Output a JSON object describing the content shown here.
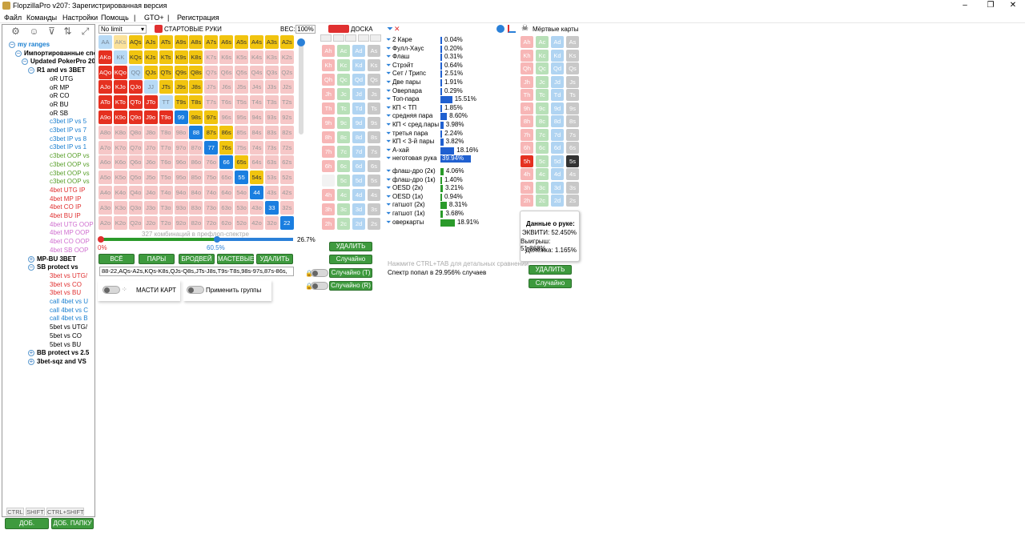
{
  "window": {
    "title": "FlopzillaPro v207: Зарегистрированная версия",
    "minimize": "–",
    "maximize": "❐",
    "close": "✕"
  },
  "menu": [
    "Файл",
    "Команды",
    "Настройки",
    "Помощь",
    "|",
    "GTO+",
    "|",
    "Регистрация"
  ],
  "tree": [
    {
      "label": "my ranges",
      "color": "#1a7fd0",
      "tog": "−",
      "indent": 0,
      "bold": true
    },
    {
      "label": "Импортированные спектры",
      "color": "#000",
      "tog": "−",
      "indent": 1,
      "bold": true
    },
    {
      "label": "Updated PokerPro 2018",
      "color": "#000",
      "tog": "−",
      "indent": 2,
      "bold": true
    },
    {
      "label": "R1 and vs 3BET",
      "color": "#000",
      "tog": "−",
      "indent": 3,
      "bold": true
    },
    {
      "label": "oR UTG",
      "color": "#000",
      "indent": 5
    },
    {
      "label": "oR MP",
      "color": "#000",
      "indent": 5
    },
    {
      "label": "oR CO",
      "color": "#000",
      "indent": 5
    },
    {
      "label": "oR BU",
      "color": "#000",
      "indent": 5
    },
    {
      "label": "oR SB",
      "color": "#000",
      "indent": 5
    },
    {
      "label": "c3bet IP vs 5",
      "color": "#1a7fd0",
      "indent": 5
    },
    {
      "label": "c3bet IP vs 7",
      "color": "#1a7fd0",
      "indent": 5
    },
    {
      "label": "c3bet IP vs 8",
      "color": "#1a7fd0",
      "indent": 5
    },
    {
      "label": "c3bet IP vs 1",
      "color": "#1a7fd0",
      "indent": 5
    },
    {
      "label": "c3bet OOP vs",
      "color": "#5aa02c",
      "indent": 5
    },
    {
      "label": "c3bet OOP vs",
      "color": "#5aa02c",
      "indent": 5
    },
    {
      "label": "c3bet OOP vs",
      "color": "#5aa02c",
      "indent": 5
    },
    {
      "label": "c3bet OOP vs",
      "color": "#5aa02c",
      "indent": 5
    },
    {
      "label": "4bet UTG IP",
      "color": "#e03030",
      "indent": 5
    },
    {
      "label": "4bet MP IP",
      "color": "#e03030",
      "indent": 5
    },
    {
      "label": "4bet CO IP",
      "color": "#e03030",
      "indent": 5
    },
    {
      "label": "4bet BU IP",
      "color": "#e03030",
      "indent": 5
    },
    {
      "label": "4bet UTG OOP",
      "color": "#d070d0",
      "indent": 5
    },
    {
      "label": "4bet MP OOP",
      "color": "#d070d0",
      "indent": 5
    },
    {
      "label": "4bet CO OOP",
      "color": "#d070d0",
      "indent": 5
    },
    {
      "label": "4bet SB OOP",
      "color": "#d070d0",
      "indent": 5
    },
    {
      "label": "MP-BU 3BET",
      "color": "#000",
      "tog": "+",
      "indent": 3,
      "bold": true
    },
    {
      "label": "SB protect vs",
      "color": "#000",
      "tog": "−",
      "indent": 3,
      "bold": true
    },
    {
      "label": "3bet vs UTG/",
      "color": "#e03030",
      "indent": 5
    },
    {
      "label": "3bet vs CO",
      "color": "#e03030",
      "indent": 5
    },
    {
      "label": "3bet vs BU",
      "color": "#e03030",
      "indent": 5
    },
    {
      "label": "call 4bet vs U",
      "color": "#1a7fd0",
      "indent": 5
    },
    {
      "label": "call 4bet vs C",
      "color": "#1a7fd0",
      "indent": 5
    },
    {
      "label": "call 4bet vs B",
      "color": "#1a7fd0",
      "indent": 5
    },
    {
      "label": "5bet vs UTG/",
      "color": "#000",
      "indent": 5
    },
    {
      "label": "5bet vs CO",
      "color": "#000",
      "indent": 5
    },
    {
      "label": "5bet vs BU",
      "color": "#000",
      "indent": 5
    },
    {
      "label": "BB protect vs 2.5",
      "color": "#000",
      "tog": "+",
      "indent": 3,
      "bold": true
    },
    {
      "label": "3bet-sqz and VS",
      "color": "#000",
      "tog": "+",
      "indent": 3,
      "bold": true
    }
  ],
  "left_bottom": {
    "ctrl": "CTRL",
    "shift": "SHIFT",
    "ctrlshift": "CTRL+SHIFT",
    "add_range": "ДОБ. СПЕКТР",
    "add_folder": "ДОБ. ПАПКУ"
  },
  "range": {
    "limit": "No limit",
    "header": "СТАРТОВЫЕ РУКИ",
    "weight_label": "ВЕС:",
    "weight": "100%",
    "ranks": [
      "A",
      "K",
      "Q",
      "J",
      "T",
      "9",
      "8",
      "7",
      "6",
      "5",
      "4",
      "3",
      "2"
    ],
    "combos": "327 комбинаций в префлоп-спектре",
    "pct": "26.7%",
    "min": "0%",
    "mid": "60.5%",
    "btn_all": "ВСЁ",
    "btn_pairs": "ПАРЫ",
    "btn_broadway": "БРОДВЕЙ",
    "btn_suited": "МАСТЕВЫЕ",
    "btn_delete": "УДАЛИТЬ",
    "text": "88-22,AQs-A2s,KQs-K8s,QJs-Q8s,JTs-J8s,T9s-T8s,98s-97s,87s-86s,",
    "suits_label": "МАСТИ КАРТ",
    "groups_label": "Применить группы",
    "selection_fraction": 0.605
  },
  "board": {
    "header": "ДОСКА",
    "delete": "УДАЛИТЬ",
    "random": "Случайно",
    "random_t": "Случайно (T)",
    "random_r": "Случайно (R)"
  },
  "stats": [
    {
      "name": "2 Каре",
      "pct": "0.04%",
      "v": 0.04,
      "g": false
    },
    {
      "name": "Фулл-Хаус",
      "pct": "0.20%",
      "v": 0.2,
      "g": false
    },
    {
      "name": "Флаш",
      "pct": "0.31%",
      "v": 0.31,
      "g": false
    },
    {
      "name": "Стрэйт",
      "pct": "0.64%",
      "v": 0.64,
      "g": false
    },
    {
      "name": "Сет / Трипс",
      "pct": "2.51%",
      "v": 2.51,
      "g": false
    },
    {
      "name": "Две пары",
      "pct": "1.91%",
      "v": 1.91,
      "g": false
    },
    {
      "name": "Оверпара",
      "pct": "0.29%",
      "v": 0.29,
      "g": false
    },
    {
      "name": "Топ-пара",
      "pct": "15.51%",
      "v": 15.51,
      "g": false
    },
    {
      "name": "КП < ТП",
      "pct": "1.85%",
      "v": 1.85,
      "g": false
    },
    {
      "name": "средняя пара",
      "pct": "8.60%",
      "v": 8.6,
      "g": false
    },
    {
      "name": "КП < сред.пары",
      "pct": "3.98%",
      "v": 3.98,
      "g": false
    },
    {
      "name": "третья пара",
      "pct": "2.24%",
      "v": 2.24,
      "g": false
    },
    {
      "name": "КП < 3-й пары",
      "pct": "3.82%",
      "v": 3.82,
      "g": false
    },
    {
      "name": "А-хай",
      "pct": "18.16%",
      "v": 18.16,
      "g": false
    },
    {
      "name": "неготовая рука",
      "pct": "39.94%",
      "v": 39.94,
      "g": false
    },
    {
      "name": "флаш-дро (2к)",
      "pct": "4.06%",
      "v": 4.06,
      "g": true
    },
    {
      "name": "флаш-дро (1к)",
      "pct": "1.40%",
      "v": 1.4,
      "g": true
    },
    {
      "name": "OESD (2к)",
      "pct": "3.21%",
      "v": 3.21,
      "g": true
    },
    {
      "name": "OESD (1к)",
      "pct": "0.94%",
      "v": 0.94,
      "g": true
    },
    {
      "name": "гатшот (2к)",
      "pct": "8.31%",
      "v": 8.31,
      "g": true
    },
    {
      "name": "гатшот (1к)",
      "pct": "3.68%",
      "v": 3.68,
      "g": true
    },
    {
      "name": "оверкарты",
      "pct": "18.91%",
      "v": 18.91,
      "g": true
    }
  ],
  "hint": "Нажмите CTRL+TAB для детальных сравнений",
  "hit": "Спектр попал в 29.956% случаев",
  "dead": {
    "header": "Мёртвые карты",
    "delete": "УДАЛИТЬ",
    "random": "Случайно"
  },
  "handinfo": {
    "title": "Данные о руке:",
    "equity": "ЭКВИТИ: 52.450%",
    "win": "Выигрыш: 51.868%",
    "split": "Делёжка: 1.165%"
  }
}
